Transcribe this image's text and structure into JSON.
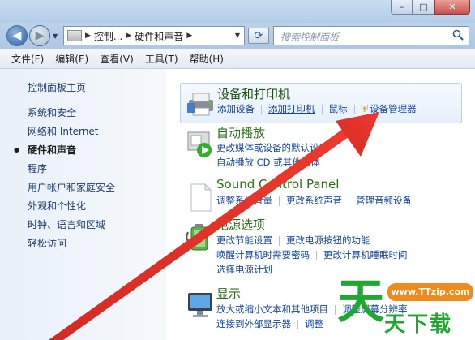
{
  "window": {
    "minimize_glyph": "–",
    "maximize_glyph": "□",
    "close_glyph": "✕"
  },
  "address": {
    "crumbs": [
      "控制...",
      "硬件和声音"
    ],
    "search_placeholder": "搜索控制面板"
  },
  "menu": [
    "文件(F)",
    "编辑(E)",
    "查看(V)",
    "工具(T)",
    "帮助(H)"
  ],
  "leftnav": {
    "home": "控制面板主页",
    "items": [
      "系统和安全",
      "网络和 Internet",
      "硬件和声音",
      "程序",
      "用户帐户和家庭安全",
      "外观和个性化",
      "时钟、语言和区域",
      "轻松访问"
    ],
    "current_index": 2
  },
  "categories": {
    "devices": {
      "title": "设备和打印机",
      "links": [
        "添加设备",
        "添加打印机",
        "鼠标",
        "设备管理器"
      ],
      "icon": "printer-icon"
    },
    "autoplay": {
      "title": "自动播放",
      "links_line1": [
        "更改媒体或设备的默认设置"
      ],
      "links_line2": [
        "自动播放 CD 或其他媒体"
      ],
      "icon": "autoplay-icon"
    },
    "sound": {
      "title": "Sound Control Panel",
      "links": [
        "调整系统音量",
        "更改系统声音",
        "管理音频设备"
      ],
      "icon": "sound-document-icon"
    },
    "power": {
      "title": "电源选项",
      "links_line1": [
        "更改节能设置",
        "更改电源按钮的功能"
      ],
      "links_line2": [
        "唤醒计算机时需要密码",
        "更改计算机睡眠时间"
      ],
      "links_line3": [
        "选择电源计划"
      ],
      "icon": "battery-icon"
    },
    "display": {
      "title": "显示",
      "links_line1": [
        "放大或缩小文本和其他项目",
        "调整屏幕分辨率"
      ],
      "links_line2": [
        "连接到外部显示器",
        "调整"
      ],
      "icon": "monitor-icon"
    }
  },
  "watermark": {
    "big": "天",
    "rest": "天下载",
    "url": "www.TTzip.com"
  },
  "colors": {
    "arrow": "#e8322a",
    "link": "#1646a0",
    "title": "#1e4d18",
    "watermark_green": "#1ea82f",
    "watermark_orange": "#f08a1c"
  }
}
